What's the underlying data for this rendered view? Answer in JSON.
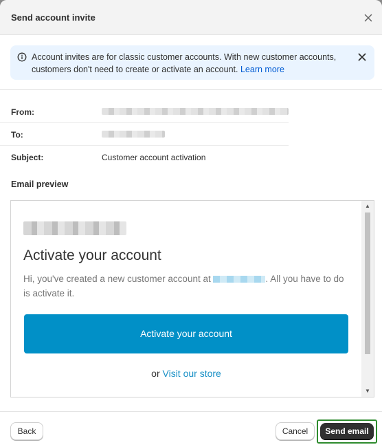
{
  "dialog": {
    "title": "Send account invite"
  },
  "banner": {
    "text": "Account invites are for classic customer accounts. With new customer accounts, customers don't need to create or activate an account.",
    "link": "Learn more"
  },
  "fields": {
    "from_label": "From:",
    "to_label": "To:",
    "subject_label": "Subject:",
    "subject_value": "Customer account activation"
  },
  "preview": {
    "section_title": "Email preview",
    "heading": "Activate your account",
    "body_before": "Hi, you've created a new customer account at ",
    "body_after": ". All you have to do is activate it.",
    "button": "Activate your account",
    "or_text": "or ",
    "store_link": "Visit our store"
  },
  "footer": {
    "back": "Back",
    "cancel": "Cancel",
    "send": "Send email"
  },
  "colors": {
    "banner_bg": "#eaf4ff",
    "activate_button": "#0190c7",
    "primary_button": "#303030",
    "focus_outline": "#2e8b2e"
  }
}
